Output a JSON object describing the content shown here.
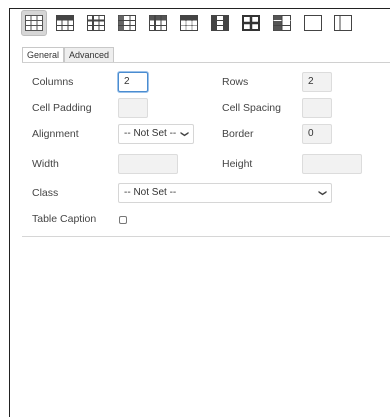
{
  "toolbar": {
    "buttons": [
      {
        "icon": "table-grid-3x3-icon"
      },
      {
        "icon": "table-header-row-icon"
      },
      {
        "icon": "table-cross-lines-icon"
      },
      {
        "icon": "table-header-left-icon"
      },
      {
        "icon": "table-header-top-left-icon"
      },
      {
        "icon": "table-dotted-header-icon"
      },
      {
        "icon": "table-dark-cols-icon"
      },
      {
        "icon": "table-bold-cross-icon"
      },
      {
        "icon": "table-left-col-icon"
      },
      {
        "icon": "table-empty-icon"
      },
      {
        "icon": "table-split-icon"
      }
    ],
    "active_index": 0
  },
  "tabs": [
    {
      "label": "General",
      "active": true
    },
    {
      "label": "Advanced",
      "active": false
    }
  ],
  "form": {
    "columns_label": "Columns",
    "columns_value": "2",
    "rows_label": "Rows",
    "rows_value": "2",
    "cell_padding_label": "Cell Padding",
    "cell_padding_value": "",
    "cell_spacing_label": "Cell Spacing",
    "cell_spacing_value": "",
    "alignment_label": "Alignment",
    "alignment_value": "-- Not Set --",
    "border_label": "Border",
    "border_value": "0",
    "width_label": "Width",
    "width_value": "",
    "height_label": "Height",
    "height_value": "",
    "class_label": "Class",
    "class_value": "-- Not Set --",
    "caption_label": "Table Caption",
    "caption_checked": false
  },
  "colors": {
    "focus_border": "#4a8cd0",
    "active_button_bg": "#d6d6d6",
    "field_bg": "#f2f2f2"
  }
}
